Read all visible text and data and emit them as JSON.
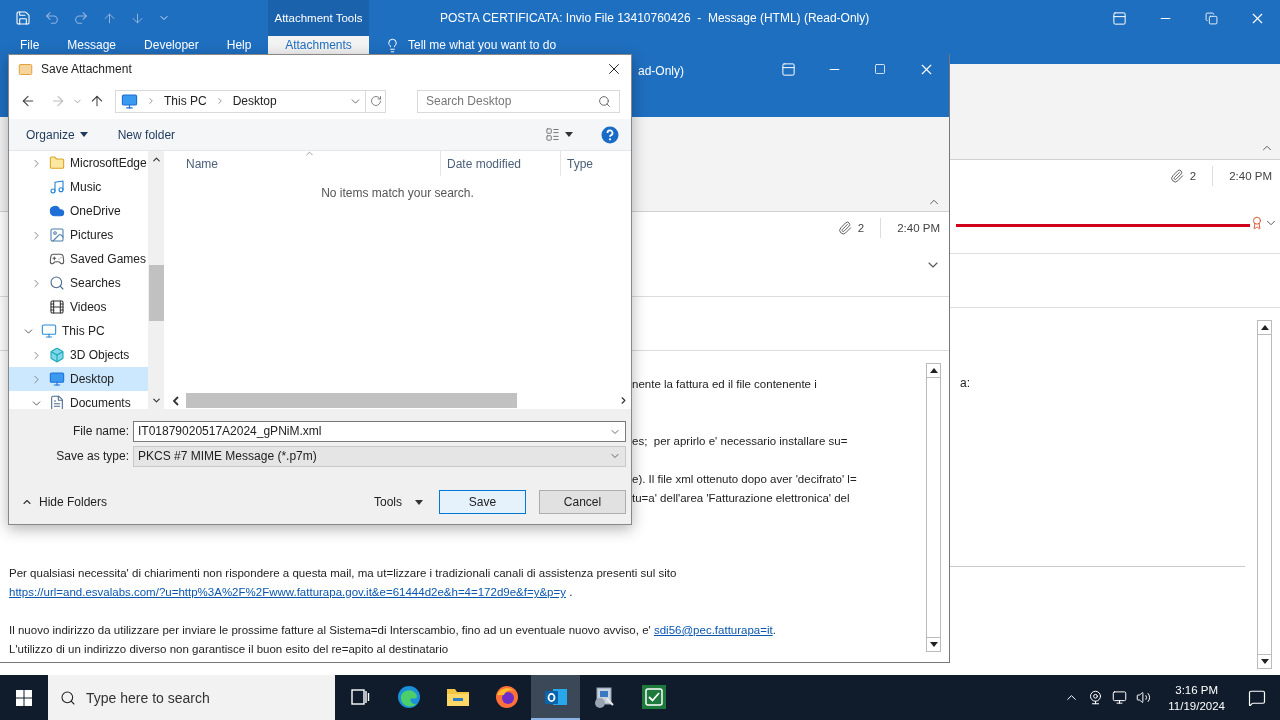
{
  "outlook": {
    "title": "POSTA CERTIFICATA: Invio File 13410760426  -  Message (HTML) (Read-Only)",
    "context_group": "Attachment Tools",
    "ribbon_tabs": [
      {
        "label": "File",
        "selected": false
      },
      {
        "label": "Message",
        "selected": false
      },
      {
        "label": "Developer",
        "selected": false
      },
      {
        "label": "Help",
        "selected": false
      },
      {
        "label": "Attachments",
        "selected": true
      }
    ],
    "tell_me": "Tell me what you want to do",
    "attachment_count": "2",
    "time": "2:40 PM",
    "body_text": "a:"
  },
  "message_window": {
    "title": "ad-Only)",
    "attachment_count": "2",
    "time": "2:40 PM",
    "paragraphs": [
      {
        "kind": "fragment",
        "lines": [
          "nente la fattura ed il file contenente i"
        ]
      },
      {
        "kind": "fragment",
        "lines": [
          "es;  per aprirlo e' necessario installare su="
        ]
      },
      {
        "kind": "fragment",
        "lines": [
          "e). Il file xml ottenuto dopo aver 'decifrato' l=",
          "tu=a' dell'area 'Fatturazione elettronica' del"
        ]
      },
      {
        "kind": "text",
        "lines": [
          "Per qualsiasi necessita' di chiarimenti non rispondere a questa mail, ma ut=lizzare i tradizionali canali di assistenza presenti sul sito"
        ],
        "link": "https://url=and.esvalabs.com/?u=http%3A%2F%2Fwww.fatturapa.gov.it&e=61444d2e&h=4=172d9e&f=y&p=y",
        "after_link": " ."
      },
      {
        "kind": "text",
        "lines": [
          "Il nuovo indirizzo da utilizzare per inviare le prossime fatture al Sistema=di Interscambio, fino ad un eventuale nuovo avviso, e' "
        ],
        "link": "sdi56@pec.fatturapa=it",
        "after_link": ".",
        "next_line": "L'utilizzo di un indirizzo diverso non garantisce il buon esito del re=apito al destinatario"
      }
    ]
  },
  "dialog": {
    "title": "Save Attachment",
    "path": [
      "This PC",
      "Desktop"
    ],
    "search_placeholder": "Search Desktop",
    "organize": "Organize",
    "new_folder": "New folder",
    "tree": {
      "partial_branch": [
        {
          "label": "MicrosoftEdge",
          "kind": "folder",
          "expanded": false,
          "selected": false
        },
        {
          "label": "Music",
          "kind": "music",
          "selected": false
        },
        {
          "label": "OneDrive",
          "kind": "cloud",
          "selected": false
        },
        {
          "label": "Pictures",
          "kind": "pictures",
          "expanded": false,
          "selected": false
        },
        {
          "label": "Saved Games",
          "kind": "games",
          "selected": false
        },
        {
          "label": "Searches",
          "kind": "search",
          "expanded": false,
          "selected": false
        },
        {
          "label": "Videos",
          "kind": "videos",
          "selected": false
        }
      ],
      "items": [
        {
          "label": "This PC",
          "kind": "pc",
          "expanded": true,
          "selected": false,
          "children": [
            {
              "label": "3D Objects",
              "kind": "objects3d",
              "expanded": false,
              "selected": false
            },
            {
              "label": "Desktop",
              "kind": "desktop",
              "expanded": false,
              "selected": true
            },
            {
              "label": "Documents",
              "kind": "documents",
              "expanded": true,
              "selected": false
            }
          ]
        }
      ]
    },
    "columns": [
      "Name",
      "Date modified",
      "Type"
    ],
    "empty_message": "No items match your search.",
    "file_name_label": "File name:",
    "file_name": "IT01879020517A2024_gPNiM.xml",
    "type_label": "Save as type:",
    "file_type": "PKCS #7 MIME Message (*.p7m)",
    "hide_folders": "Hide Folders",
    "tools": "Tools",
    "save": "Save",
    "cancel": "Cancel"
  },
  "taskbar": {
    "search_placeholder": "Type here to search",
    "apps": [
      {
        "kind": "task-view",
        "selected": false
      },
      {
        "kind": "browser",
        "selected": false
      },
      {
        "kind": "files",
        "selected": false
      },
      {
        "kind": "fox",
        "selected": false
      },
      {
        "kind": "mail",
        "selected": true
      },
      {
        "kind": "installer",
        "selected": false
      },
      {
        "kind": "check",
        "selected": false
      }
    ],
    "time": "3:16 PM",
    "date": "11/19/2024"
  }
}
